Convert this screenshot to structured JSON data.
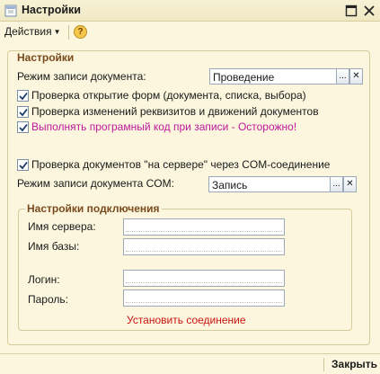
{
  "window": {
    "title": "Настройки",
    "icon": "settings-form-icon",
    "maximize_icon": "maximize-icon",
    "close_icon": "close-icon"
  },
  "menu": {
    "actions_label": "Действия",
    "help_label": "?"
  },
  "settings_group": {
    "title": "Настройки",
    "doc_write_mode_label": "Режим записи документа:",
    "doc_write_mode_value": "Проведение",
    "check_form_open": {
      "label": "Проверка открытие форм (документа, списка, выбора)",
      "checked": true
    },
    "check_changes": {
      "label": "Проверка изменений реквизитов и движений документов",
      "checked": true
    },
    "run_code_on_write": {
      "label": "Выполнять програмный код при записи - Осторожно!",
      "checked": true,
      "color": "#c0189b"
    },
    "check_server_com": {
      "label": "Проверка документов \"на сервере\" через COM-соединение",
      "checked": true
    },
    "com_write_mode_label": "Режим записи документа COM:",
    "com_write_mode_value": "Запись"
  },
  "connection_group": {
    "title": "Настройки подключения",
    "server_label": "Имя сервера:",
    "server_value": "",
    "database_label": "Имя базы:",
    "database_value": "",
    "login_label": "Логин:",
    "login_value": "",
    "password_label": "Пароль:",
    "password_value": "",
    "connect_link": "Установить соединение",
    "link_color": "#cc1515"
  },
  "footer": {
    "close_label": "Закрыть"
  },
  "field_buttons": {
    "select_label": "...",
    "clear_label": "✕"
  }
}
